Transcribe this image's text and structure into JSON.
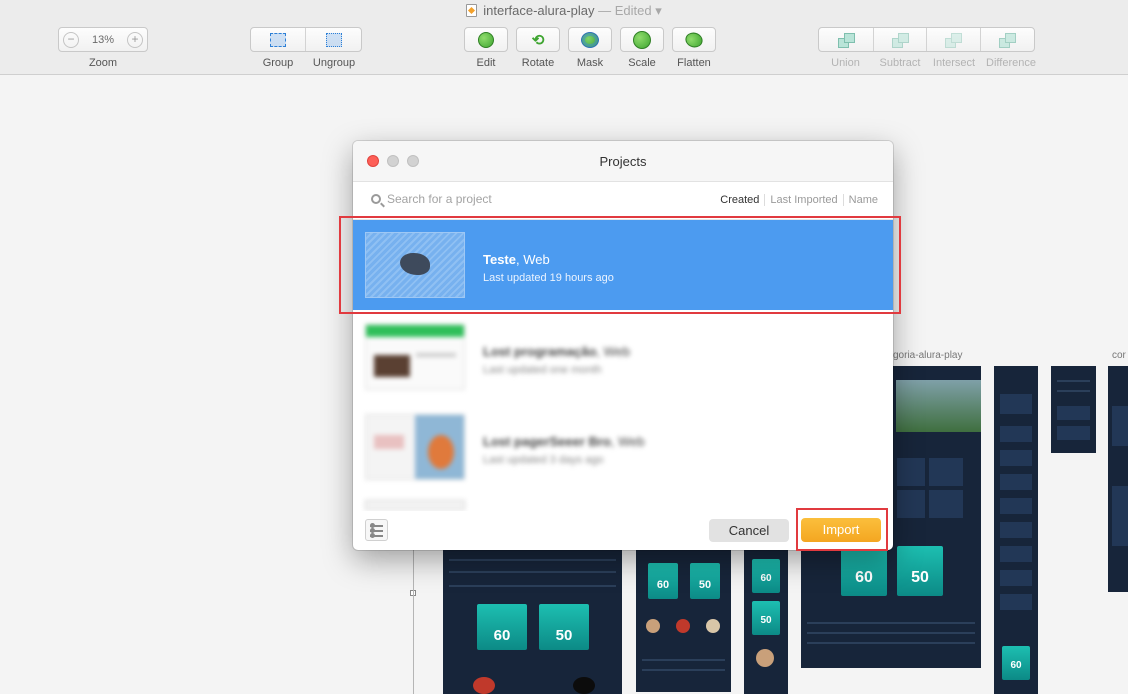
{
  "document": {
    "name": "interface-alura-play",
    "status": " — Edited"
  },
  "toolbar": {
    "zoom": {
      "value": "13%",
      "label": "Zoom",
      "minus": "−",
      "plus": "+"
    },
    "group_label": "Group",
    "ungroup_label": "Ungroup",
    "edit_label": "Edit",
    "rotate_label": "Rotate",
    "mask_label": "Mask",
    "scale_label": "Scale",
    "flatten_label": "Flatten",
    "union_label": "Union",
    "subtract_label": "Subtract",
    "intersect_label": "Intersect",
    "difference_label": "Difference"
  },
  "canvas": {
    "artboard_labels": [
      "goria-alura-play",
      "cor"
    ],
    "price_labels": [
      "60",
      "50",
      "60",
      "50",
      "60",
      "50",
      "60",
      "50",
      "60"
    ]
  },
  "modal": {
    "title": "Projects",
    "search_placeholder": "Search for a project",
    "sort_tabs": [
      {
        "label": "Created",
        "active": true
      },
      {
        "label": "Last Imported",
        "active": false
      },
      {
        "label": "Name",
        "active": false
      }
    ],
    "projects": [
      {
        "name": "Teste",
        "platform": ", Web",
        "updated": "Last updated 19 hours ago",
        "selected": true
      },
      {
        "name": "Lost programação",
        "platform": ", Web",
        "updated": "Last updated one month",
        "selected": false
      },
      {
        "name": "Lost pagerSeeer Bro",
        "platform": ", Web",
        "updated": "Last updated 3 days ago",
        "selected": false
      }
    ],
    "cancel_label": "Cancel",
    "import_label": "Import"
  },
  "colors": {
    "selection": "#4c9bf0",
    "import_button": "#f4a621",
    "highlight": "#e13a3f",
    "artboard_bg": "#17253a",
    "card_teal": "#1dbfb1"
  }
}
